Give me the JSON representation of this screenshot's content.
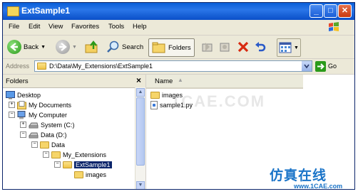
{
  "window": {
    "title": "ExtSample1",
    "controls": {
      "minimize": "_",
      "maximize": "□",
      "close": "✕"
    }
  },
  "menubar": {
    "items": [
      "File",
      "Edit",
      "View",
      "Favorites",
      "Tools",
      "Help"
    ]
  },
  "toolbar": {
    "back_label": "Back",
    "search_label": "Search",
    "folders_label": "Folders"
  },
  "addressbar": {
    "label": "Address",
    "value": "D:\\Data\\My_Extensions\\ExtSample1",
    "go_label": "Go"
  },
  "folders_pane": {
    "title": "Folders",
    "close": "×",
    "tree": [
      {
        "label": "Desktop"
      },
      {
        "label": "My Documents",
        "toggle": "+"
      },
      {
        "label": "My Computer",
        "toggle": "−"
      },
      {
        "label": "System (C:)",
        "toggle": "+"
      },
      {
        "label": "Data (D:)",
        "toggle": "−"
      },
      {
        "label": "Data",
        "toggle": "−"
      },
      {
        "label": "My_Extensions",
        "toggle": "−"
      },
      {
        "label": "ExtSample1",
        "toggle": "−"
      },
      {
        "label": "images"
      }
    ]
  },
  "content": {
    "column_name": "Name",
    "sort_arrow": "▲",
    "items": [
      {
        "name": "images",
        "type": "folder"
      },
      {
        "name": "sample1.py",
        "type": "file"
      }
    ]
  },
  "watermark": {
    "text": "仿真在线",
    "url": "www.1CAE.com",
    "faint": "1CAE.COM"
  },
  "colors": {
    "titlebar": "#0a5fd8",
    "selection": "#0a246a",
    "watermark": "#1a74c8"
  }
}
